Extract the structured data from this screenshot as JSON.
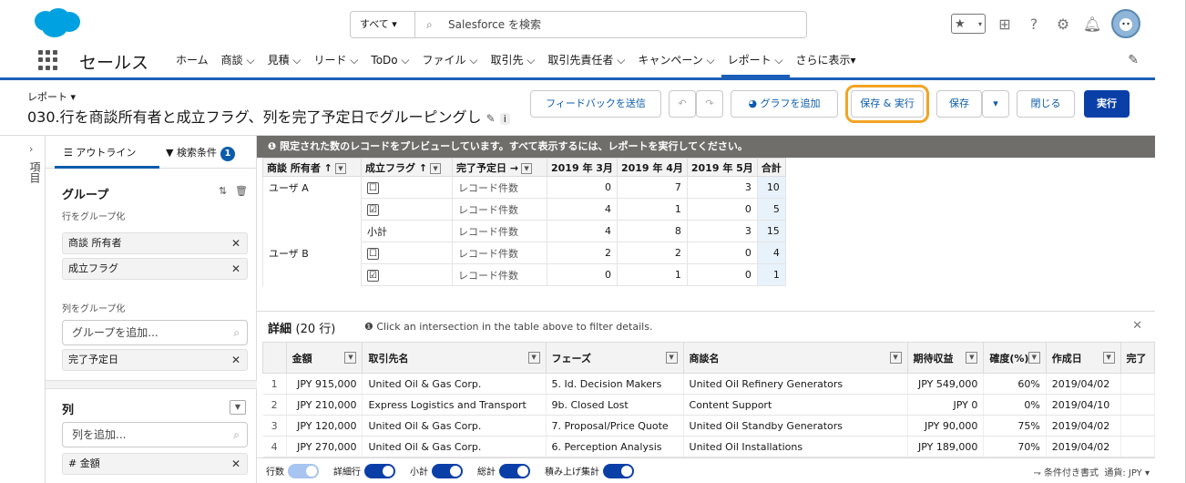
{
  "header": {
    "search_scope": "すべて ▾",
    "search_placeholder": "Salesforce を検索"
  },
  "nav": {
    "app_name": "セールス",
    "items": [
      "ホーム",
      "商談 ⌵",
      "見積 ⌵",
      "リード ⌵",
      "ToDo ⌵",
      "ファイル ⌵",
      "取引先 ⌵",
      "取引先責任者 ⌵",
      "キャンペーン ⌵",
      "レポート ⌵",
      "さらに表示▾"
    ],
    "active_index": 9
  },
  "report": {
    "label": "レポート ▾",
    "title": "030.行を商談所有者と成立フラグ、列を完了予定日でグルーピングし"
  },
  "toolbar": {
    "feedback": "フィードバックを送信",
    "add_chart": "グラフを追加",
    "save_run": "保存 & 実行",
    "save": "保存",
    "close": "閉じる",
    "run": "実行"
  },
  "rail": {
    "label": "項目"
  },
  "sidepanel": {
    "tab_outline": "☰ アウトライン",
    "tab_filters": "▼ 検索条件",
    "filter_count": "1",
    "groups_h": "グループ",
    "rows_sub": "行をグループ化",
    "row_groups": [
      "商談 所有者",
      "成立フラグ"
    ],
    "cols_sub": "列をグループ化",
    "add_group_placeholder": "グループを追加...",
    "col_group": "完了予定日",
    "columns_h": "列",
    "add_column_placeholder": "列を追加...",
    "first_column": "# 金額"
  },
  "banner": "❶ 限定された数のレコードをプレビューしています。すべて表示するには、レポートを実行してください。",
  "matrix": {
    "headers": [
      "商談 所有者 ↑",
      "成立フラグ ↑",
      "完了予定日 →",
      "2019 年 3月",
      "2019 年 4月",
      "2019 年 5月",
      "合計"
    ],
    "rows": [
      [
        "ユーザ A",
        "☐",
        "レコード件数",
        "0",
        "7",
        "3",
        "10"
      ],
      [
        "",
        "☑",
        "レコード件数",
        "4",
        "1",
        "0",
        "5"
      ],
      [
        "",
        "小計",
        "レコード件数",
        "4",
        "8",
        "3",
        "15"
      ],
      [
        "ユーザ B",
        "☐",
        "レコード件数",
        "2",
        "2",
        "0",
        "4"
      ],
      [
        "",
        "☑",
        "レコード件数",
        "0",
        "1",
        "0",
        "1"
      ]
    ]
  },
  "detail": {
    "title": "詳細",
    "count": "(20 行)",
    "info": "Click an intersection in the table above to filter details.",
    "headers": [
      "",
      "金額",
      "取引先名",
      "フェーズ",
      "商談名",
      "期待収益",
      "確度(%)",
      "作成日",
      "完了"
    ],
    "rows": [
      [
        "1",
        "JPY 915,000",
        "United Oil & Gas Corp.",
        "5. Id. Decision Makers",
        "United Oil Refinery Generators",
        "JPY 549,000",
        "60%",
        "2019/04/02",
        ""
      ],
      [
        "2",
        "JPY 210,000",
        "Express Logistics and Transport",
        "9b. Closed Lost",
        "Content Support",
        "JPY 0",
        "0%",
        "2019/04/10",
        ""
      ],
      [
        "3",
        "JPY 120,000",
        "United Oil & Gas Corp.",
        "7. Proposal/Price Quote",
        "United Oil Standby Generators",
        "JPY 90,000",
        "75%",
        "2019/04/02",
        ""
      ],
      [
        "4",
        "JPY 270,000",
        "United Oil & Gas Corp.",
        "6. Perception Analysis",
        "United Oil Installations",
        "JPY 189,000",
        "70%",
        "2019/04/02",
        ""
      ]
    ]
  },
  "footer": {
    "row_count": "行数",
    "detail_rows": "詳細行",
    "subtotal": "小計",
    "grand_total": "総計",
    "stacked": "積み上げ集計",
    "conditional": "⇁ 条件付き書式",
    "currency": "通貨: JPY ▾"
  },
  "colors": {
    "brand": "#0b3fa8",
    "highlight": "#f3a423",
    "banner": "#706e6b"
  }
}
